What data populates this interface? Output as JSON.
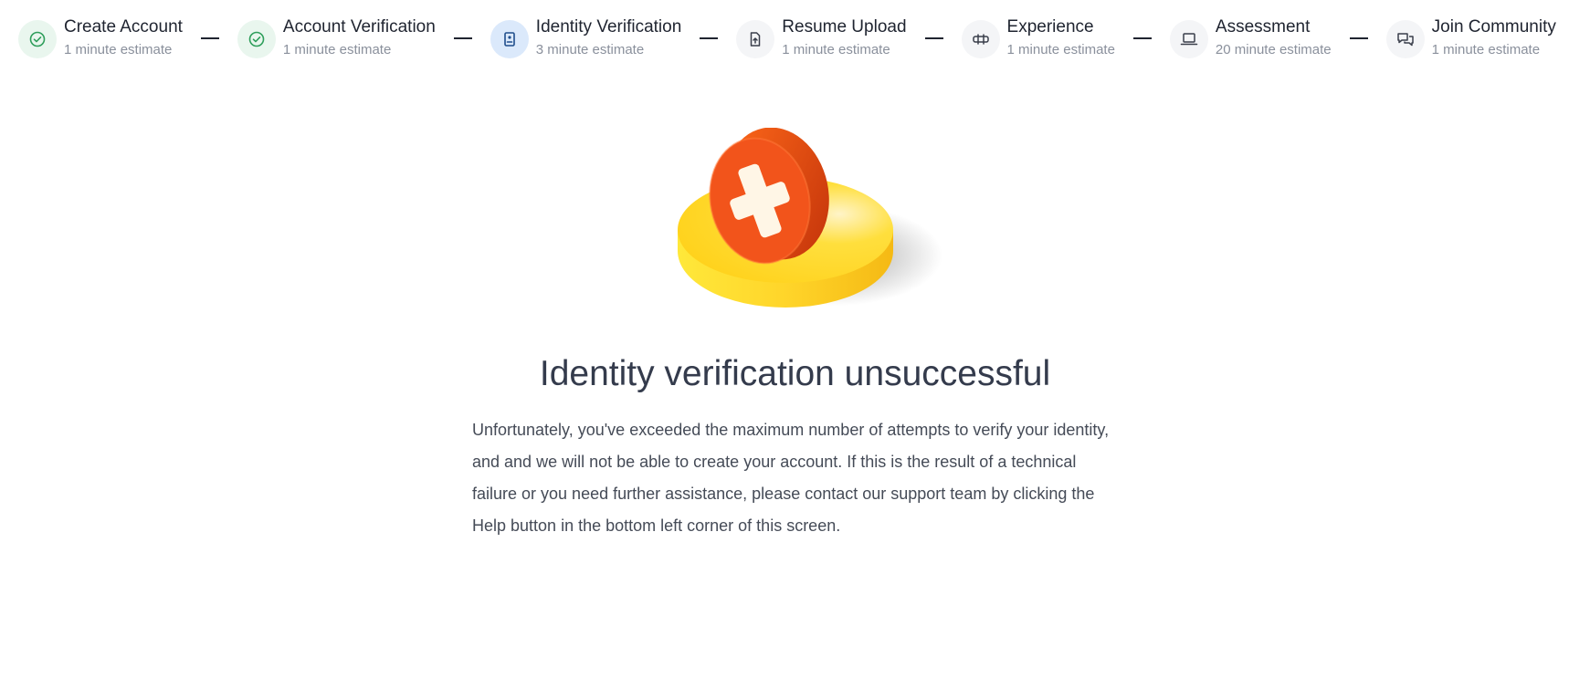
{
  "stepper": {
    "steps": [
      {
        "title": "Create Account",
        "estimate": "1 minute estimate",
        "state": "done",
        "icon": "check-circle-icon"
      },
      {
        "title": "Account Verification",
        "estimate": "1 minute estimate",
        "state": "done",
        "icon": "check-circle-icon"
      },
      {
        "title": "Identity Verification",
        "estimate": "3 minute estimate",
        "state": "active",
        "icon": "id-badge-icon"
      },
      {
        "title": "Resume Upload",
        "estimate": "1 minute estimate",
        "state": "pending",
        "icon": "file-upload-icon"
      },
      {
        "title": "Experience",
        "estimate": "1 minute estimate",
        "state": "pending",
        "icon": "experience-icon"
      },
      {
        "title": "Assessment",
        "estimate": "20 minute estimate",
        "state": "pending",
        "icon": "laptop-icon"
      },
      {
        "title": "Join Community",
        "estimate": "1 minute estimate",
        "state": "pending",
        "icon": "chat-bubbles-icon"
      }
    ]
  },
  "colors": {
    "done_icon": "#2e9e5b",
    "active_icon": "#1f4e8c",
    "pending_icon": "#3a3f4b",
    "disc_yellow": "#ffd633",
    "badge_orange": "#f0521c"
  },
  "main": {
    "hero_icon": "error-x-badge-illustration",
    "title": "Identity verification unsuccessful",
    "message": "Unfortunately, you've exceeded the maximum number of attempts to verify your identity, and and we will not be able to create your account. If this is the result of a technical failure or you need further assistance, please contact our support team by clicking the Help button in the bottom left corner of this screen."
  }
}
